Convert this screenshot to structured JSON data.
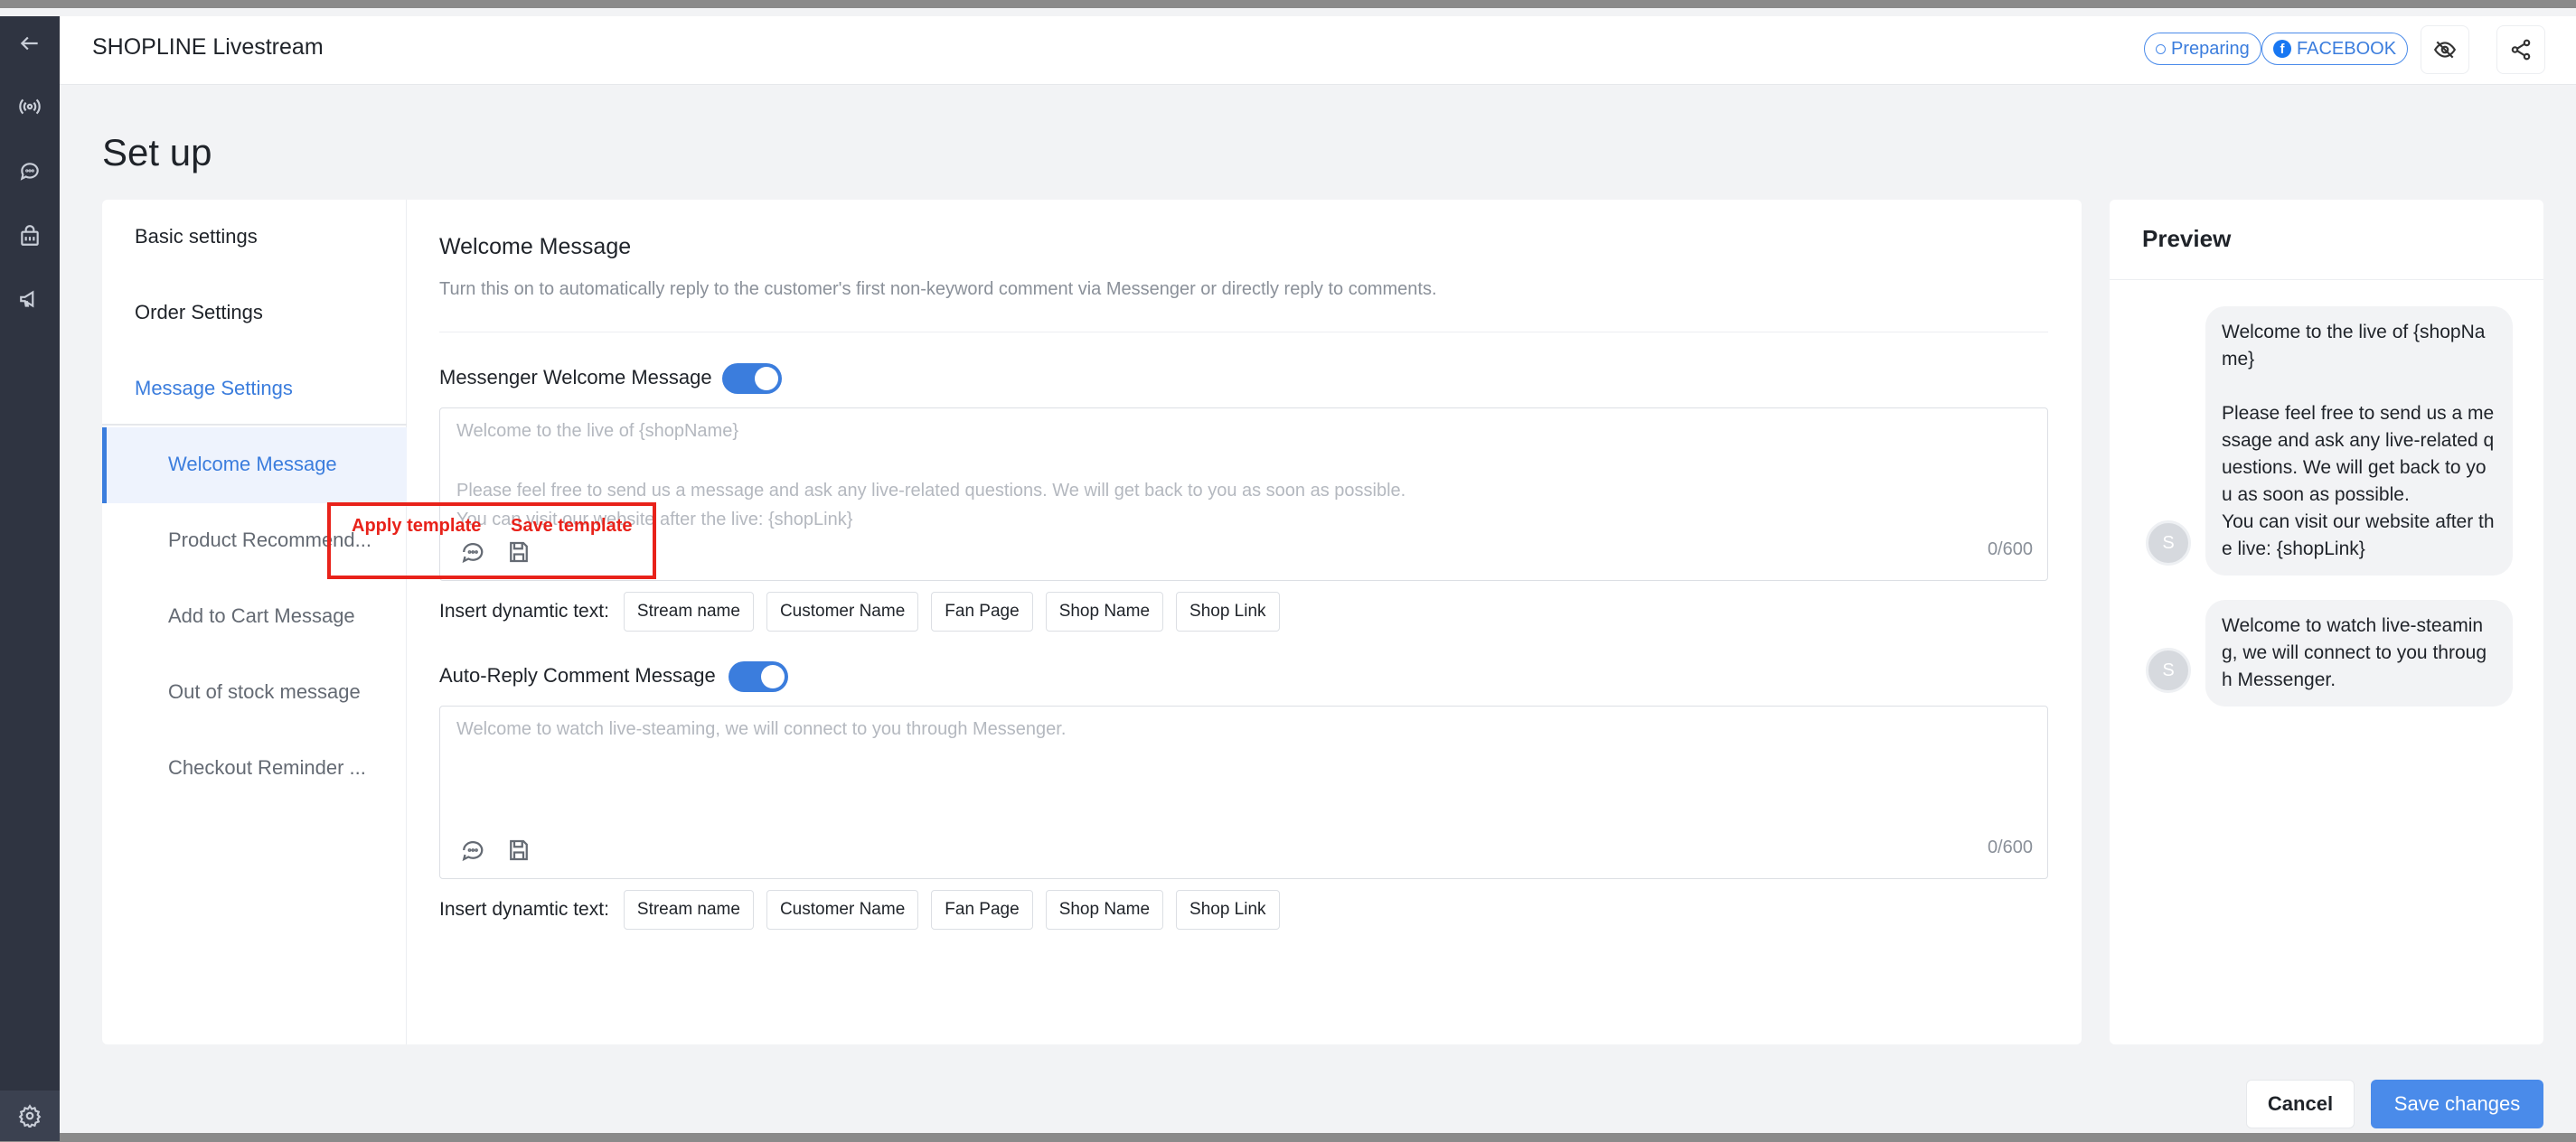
{
  "header": {
    "app_title": "SHOPLINE Livestream",
    "status_badge": "Preparing",
    "platform_badge": "FACEBOOK",
    "colors": {
      "accent": "#3b7ddd",
      "annotation": "#e8221a"
    }
  },
  "page": {
    "title": "Set up"
  },
  "nav": {
    "items": [
      {
        "label": "Basic settings"
      },
      {
        "label": "Order Settings"
      },
      {
        "label": "Message Settings"
      }
    ],
    "sub_items": [
      {
        "label": "Welcome Message"
      },
      {
        "label": "Product Recommend..."
      },
      {
        "label": "Add to Cart Message"
      },
      {
        "label": "Out of stock message"
      },
      {
        "label": "Checkout Reminder ..."
      }
    ]
  },
  "section": {
    "title": "Welcome Message",
    "description": "Turn this on to automatically reply to the customer's first non-keyword comment via Messenger or directly reply to comments."
  },
  "messenger": {
    "label": "Messenger Welcome Message",
    "enabled": true,
    "placeholder_line1": "Welcome to the live of {shopName}",
    "placeholder_line2": "Please feel free to send us a message and ask any live-related questions. We will get back to you as soon as possible.",
    "placeholder_line3": "You can visit our website after the live: {shopLink}",
    "count": "0/600"
  },
  "autoreply": {
    "label": "Auto-Reply Comment Message",
    "enabled": true,
    "placeholder": "Welcome to watch live-steaming, we will connect to you through Messenger.",
    "count": "0/600"
  },
  "insert": {
    "label": "Insert dynamtic text:",
    "chips": [
      "Stream name",
      "Customer Name",
      "Fan Page",
      "Shop Name",
      "Shop Link"
    ]
  },
  "annotation": {
    "apply": "Apply template",
    "save": "Save template"
  },
  "preview": {
    "title": "Preview",
    "avatar_initial": "S",
    "bubble1": "Welcome to the live of {shopName}\n\nPlease feel free to send us a message and ask any live-related questions. We will get back to you as soon as possible.\nYou can visit our website after the live: {shopLink}",
    "bubble2": "Welcome to watch live-steaming, we will connect to you through Messenger."
  },
  "footer": {
    "cancel": "Cancel",
    "save": "Save changes"
  }
}
